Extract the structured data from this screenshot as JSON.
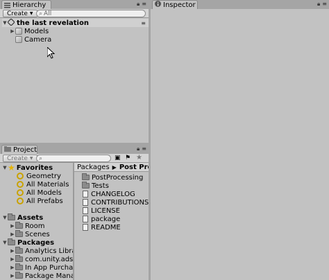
{
  "hierarchy": {
    "tab_label": "Hierarchy",
    "create_label": "Create",
    "search_placeholder": "All",
    "scene_name": "the last revelation",
    "items": [
      {
        "label": "Models"
      },
      {
        "label": "Camera"
      }
    ]
  },
  "inspector": {
    "tab_label": "Inspector"
  },
  "project": {
    "tab_label": "Project",
    "create_label": "Create",
    "favorites_label": "Favorites",
    "favorites": [
      {
        "label": "Geometry"
      },
      {
        "label": "All Materials"
      },
      {
        "label": "All Models"
      },
      {
        "label": "All Prefabs"
      }
    ],
    "assets_label": "Assets",
    "assets": [
      {
        "label": "Room"
      },
      {
        "label": "Scenes"
      }
    ],
    "packages_label": "Packages",
    "packages": [
      {
        "label": "Analytics Library"
      },
      {
        "label": "com.unity.ads"
      },
      {
        "label": "In App Purchasi"
      },
      {
        "label": "Package Manag"
      }
    ],
    "breadcrumb": {
      "root": "Packages",
      "current": "Post Proce"
    },
    "files": [
      {
        "label": "PostProcessing",
        "kind": "folder"
      },
      {
        "label": "Tests",
        "kind": "folder"
      },
      {
        "label": "CHANGELOG",
        "kind": "file"
      },
      {
        "label": "CONTRIBUTIONS",
        "kind": "file"
      },
      {
        "label": "LICENSE",
        "kind": "file"
      },
      {
        "label": "package",
        "kind": "file"
      },
      {
        "label": "README",
        "kind": "file"
      }
    ]
  }
}
